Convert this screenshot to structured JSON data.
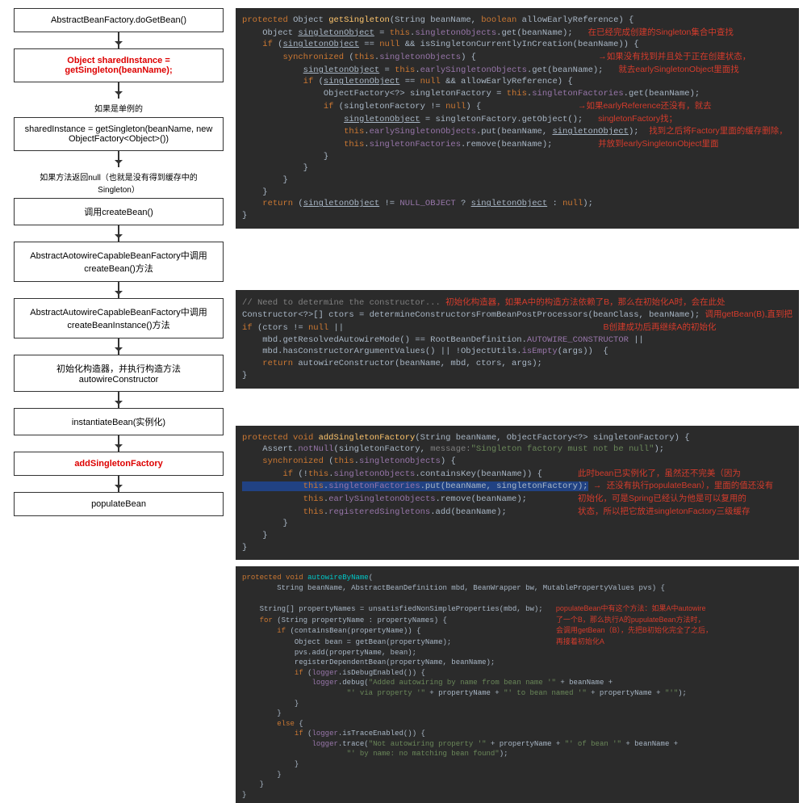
{
  "flow": {
    "b1": "AbstractBeanFactory.doGetBean()",
    "b2a": "Object sharedInstance =",
    "b2b": "getSingleton(beanName);",
    "n1": "如果是单例的",
    "b3": "sharedInstance = getSingleton(beanName, new ObjectFactory<Object>())",
    "n2": "如果方法返回null（也就是没有得到缓存中的Singleton）",
    "b4": "调用createBean()",
    "b5": "AbstractAotowireCapableBeanFactory中调用createBean()方法",
    "b6": "AbstractAutowireCapableBeanFactory中调用createBeanInstance()方法",
    "b7": "初始化构造器，并执行构造方法autowireConstructor",
    "b8": "instantiateBean(实例化)",
    "b9": "addSingletonFactory",
    "b10": "populateBean"
  },
  "code1": {
    "l1": "protected Object getSingleton(String beanName, boolean allowEarlyReference) {",
    "l2a": "    Object singletonObject = this.singletonObjects.get(beanName);",
    "l2ann": "在已经完成创建的Singleton集合中查找",
    "l3": "    if (singletonObject == null && isSingletonCurrentlyInCreation(beanName)) {",
    "l4": "        synchronized (this.singletonObjects) {",
    "l5": "            singletonObject = this.earlySingletonObjects.get(beanName);",
    "l5ann1": "如果没有找到并且处于正在创建状态，",
    "l5ann2": "就去earlySingletonObject里面找",
    "l6": "            if (singletonObject == null && allowEarlyReference) {",
    "l7": "                ObjectFactory<?> singletonFactory = this.singletonFactories.get(beanName);",
    "l8": "                if (singletonFactory != null) {",
    "l9": "                    singletonObject = singletonFactory.getObject();",
    "l9ann1": "如果earlyReference还没有，就去",
    "l9ann2": "singletonFactory找；",
    "l10": "                    this.earlySingletonObjects.put(beanName, singletonObject);",
    "l10ann": "找到之后将Factory里面的缓存删除，",
    "l11": "                    this.singletonFactories.remove(beanName);",
    "l11ann": "并放到earlySingletonObject里面",
    "l12": "                }",
    "l13": "            }",
    "l14": "        }",
    "l15": "    }",
    "l16": "    return (singletonObject != NULL_OBJECT ? singletonObject : null);",
    "l17": "}"
  },
  "code2": {
    "l1a": "// Need to determine the constructor...",
    "l1ann": "初始化构造器，如果A中的构造方法依赖了B，那么在初始化A时，会在此处",
    "l2": "Constructor<?>[] ctors = determineConstructorsFromBeanPostProcessors(beanClass, beanName);",
    "l2ann1": "调用getBean(B),直到把",
    "l2ann2": "B创建成功后再继续A的初始化",
    "l3": "if (ctors != null ||",
    "l4": "    mbd.getResolvedAutowireMode() == RootBeanDefinition.AUTOWIRE_CONSTRUCTOR ||",
    "l5": "    mbd.hasConstructorArgumentValues() || !ObjectUtils.isEmpty(args))  {",
    "l6": "    return autowireConstructor(beanName, mbd, ctors, args);",
    "l7": "}"
  },
  "code3": {
    "l1": "protected void addSingletonFactory(String beanName, ObjectFactory<?> singletonFactory) {",
    "l2a": "    Assert.notNull(singletonFactory, ",
    "l2msg": "message:",
    "l2b": "\"Singleton factory must not be null\");",
    "l3": "    synchronized (this.singletonObjects) {",
    "l4": "        if (!this.singletonObjects.containsKey(beanName)) {",
    "l4ann1": "此时bean已实例化了，虽然还不完美（因为",
    "l5": "            this.singletonFactories.put(beanName, singletonFactory);",
    "l5ann": "还没有执行populateBean），里面的值还没有",
    "l6": "            this.earlySingletonObjects.remove(beanName);",
    "l6ann": "初始化，可是Spring已经认为他是可以复用的",
    "l7": "            this.registeredSingletons.add(beanName);",
    "l7ann": "状态，所以把它放进singletonFactory三级缓存",
    "l8": "        }",
    "l9": "    }",
    "l10": "}"
  },
  "code4": {
    "l1": "protected void autowireByName(",
    "l2": "        String beanName, AbstractBeanDefinition mbd, BeanWrapper bw, MutablePropertyValues pvs) {",
    "l3": "    String[] propertyNames = unsatisfiedNonSimpleProperties(mbd, bw);",
    "l3ann1": "populateBean中有这个方法：如果A中autowire",
    "l4": "    for (String propertyName : propertyNames) {",
    "l4ann": "了一个B，那么执行A的pupulateBean方法时，",
    "l5": "        if (containsBean(propertyName)) {",
    "l5ann": "会调用getBean（B），先把B初始化完全了之后，",
    "l6": "            Object bean = getBean(propertyName);",
    "l6ann": "再接着初始化A",
    "l7": "            pvs.add(propertyName, bean);",
    "l8": "            registerDependentBean(propertyName, beanName);",
    "l9": "            if (logger.isDebugEnabled()) {",
    "l10": "                logger.debug(\"Added autowiring by name from bean name '\" + beanName +",
    "l11": "                        \"' via property '\" + propertyName + \"' to bean named '\" + propertyName + \"'\");",
    "l12": "            }",
    "l13": "        }",
    "l14": "        else {",
    "l15": "            if (logger.isTraceEnabled()) {",
    "l16": "                logger.trace(\"Not autowiring property '\" + propertyName + \"' of bean '\" + beanName +",
    "l17": "                        \"' by name: no matching bean found\");",
    "l18": "            }",
    "l19": "        }",
    "l20": "    }",
    "l21": "}"
  }
}
